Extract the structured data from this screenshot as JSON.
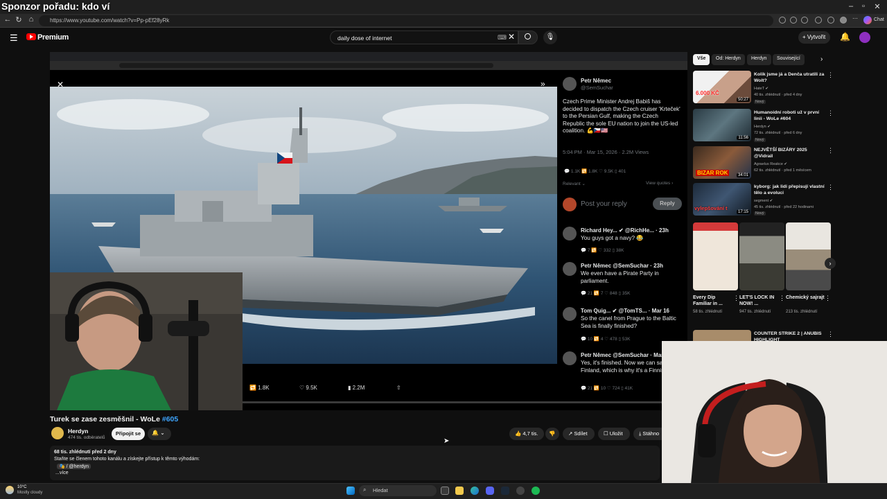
{
  "stream_overlay": {
    "title": "Sponzor pořadu: kdo ví"
  },
  "browser": {
    "url": "https://www.youtube.com/watch?v=Pp-pEf28yRk",
    "window_controls": [
      "–",
      "▫",
      "✕"
    ]
  },
  "youtube_header": {
    "logo_label": "Premium",
    "search_value": "daily dose of internet",
    "create_label": "+ Vytvořit"
  },
  "video": {
    "title": "Turek se zase zesměšnil - WoLe",
    "title_tag": "#605",
    "channel_name": "Herdyn",
    "subscribers": "474 tis. odběratelů",
    "subscribe_label": "Připojit se",
    "notify_label": "🔔 ⌄",
    "actions": {
      "like": "👍 4,7 tis.",
      "dislike": "👎",
      "share": "↗ Sdílet",
      "save": "☐ Uložit",
      "download": "⤓ Stáhno"
    },
    "description": {
      "views_date": "68 tis. zhlédnutí  před 2 dny",
      "line1": "Staňte se členem tohoto kanálu a získejte přístup k těmto výhodám:",
      "line2": "🎭 / @herdyn",
      "more": "...více"
    }
  },
  "tweet_main": {
    "name": "Petr Němec",
    "handle": "@SemSuchar",
    "text": "Czech Prime Minister Andrej Babiš has decided to dispatch the Czech cruiser 'Krteček' to the Persian Gulf, making the Czech Republic the sole EU nation to join the US-led coalition. 💪🇨🇿🇺🇸",
    "meta": "5:04 PM · Mar 15, 2026 · 2.2M Views",
    "stats": "💬 1.1K   🔁 1.8K   ♡ 9.5K   ▯ 401",
    "relevant": "Relevant ⌄",
    "view_quotes": "View quotes ›",
    "reply_placeholder": "Post your reply",
    "reply_button": "Reply"
  },
  "tweet_replies": [
    {
      "name": "Richard Hey... ✔ @RichHe... · 23h",
      "text": "You guys got a navy? 😂",
      "stats": "💬 7   🔁   ♡ 332   ▯ 38K"
    },
    {
      "name": "Petr Němec  @SemSuchar · 23h",
      "text": "We even have a Pirate Party in parliament.",
      "stats": "💬 21   🔁 7   ♡ 848   ▯ 35K"
    },
    {
      "name": "Tom Quig... ✔ @TomTS... · Mar 16",
      "text": "So the canel from Prague to the Baltic Sea is finally finished?",
      "stats": "💬 10   🔁 4   ♡ 478   ▯ 53K"
    },
    {
      "name": "Petr Němec  @SemSuchar · Mar",
      "text": "Yes, it's finished. Now we can sail to Finland, which is why it's a Finnish canal.",
      "stats": "💬 21   🔁 10   ♡ 724   ▯ 41K"
    }
  ],
  "media_stats": {
    "retweets": "🔁 1.8K",
    "likes": "♡ 9.5K",
    "views": "▮ 2.2M",
    "share": "⇧"
  },
  "sidebar": {
    "chips": [
      "Vše",
      "Od: Herdyn",
      "Herdyn",
      "Související"
    ],
    "recommendations": [
      {
        "title": "Kolik jsme já a Denča utratili za Wolt?",
        "channel": "HateT ✔",
        "meta": "40 tis. zhlédnutí · před 4 dny",
        "badge": "Nový",
        "duration": "50:27",
        "thumb_text": "6.000 KČ"
      },
      {
        "title": "Humanoidní roboti už v první linii - WoLe #604",
        "channel": "Herdyn ✔",
        "meta": "72 tis. zhlédnutí · před 6 dny",
        "badge": "Nový",
        "duration": "11:56",
        "thumb_text": ""
      },
      {
        "title": "NEJVĚTŠÍ BIZÁRY 2025 @Vidrail",
        "channel": "Agraelus Reakce ✔",
        "meta": "62 tis. zhlédnutí · před 1 měsícem",
        "badge": "",
        "duration": "34:01",
        "thumb_text": "BIZAR ROK"
      },
      {
        "title": "kyborg: jak lidi přepisují vlastní tělo a evoluci",
        "channel": "segment ✔",
        "meta": "45 tis. zhlédnutí · před 22 hodinami",
        "badge": "Nový",
        "duration": "17:15",
        "thumb_text": "vylepšování t"
      }
    ],
    "shorts": [
      {
        "title": "Every Dip Familiar in ...",
        "meta": "58 tis. zhlédnutí"
      },
      {
        "title": "LET'S LOCK IN NOW! ...",
        "meta": "947 tis. zhlédnutí"
      },
      {
        "title": "Chemický sajrajt",
        "meta": "213 tis. zhlédnutí"
      }
    ],
    "next_rec_title": "COUNTER STRIKE 2 | ANUBIS HIGHLIGHT"
  },
  "taskbar": {
    "weather_temp": "10°C",
    "weather_desc": "Mostly cloudy",
    "search_label": "Hledat"
  },
  "colors": {
    "accent_red": "#ff0000",
    "link_blue": "#3ea6ff",
    "bg": "#0f0f0f"
  }
}
